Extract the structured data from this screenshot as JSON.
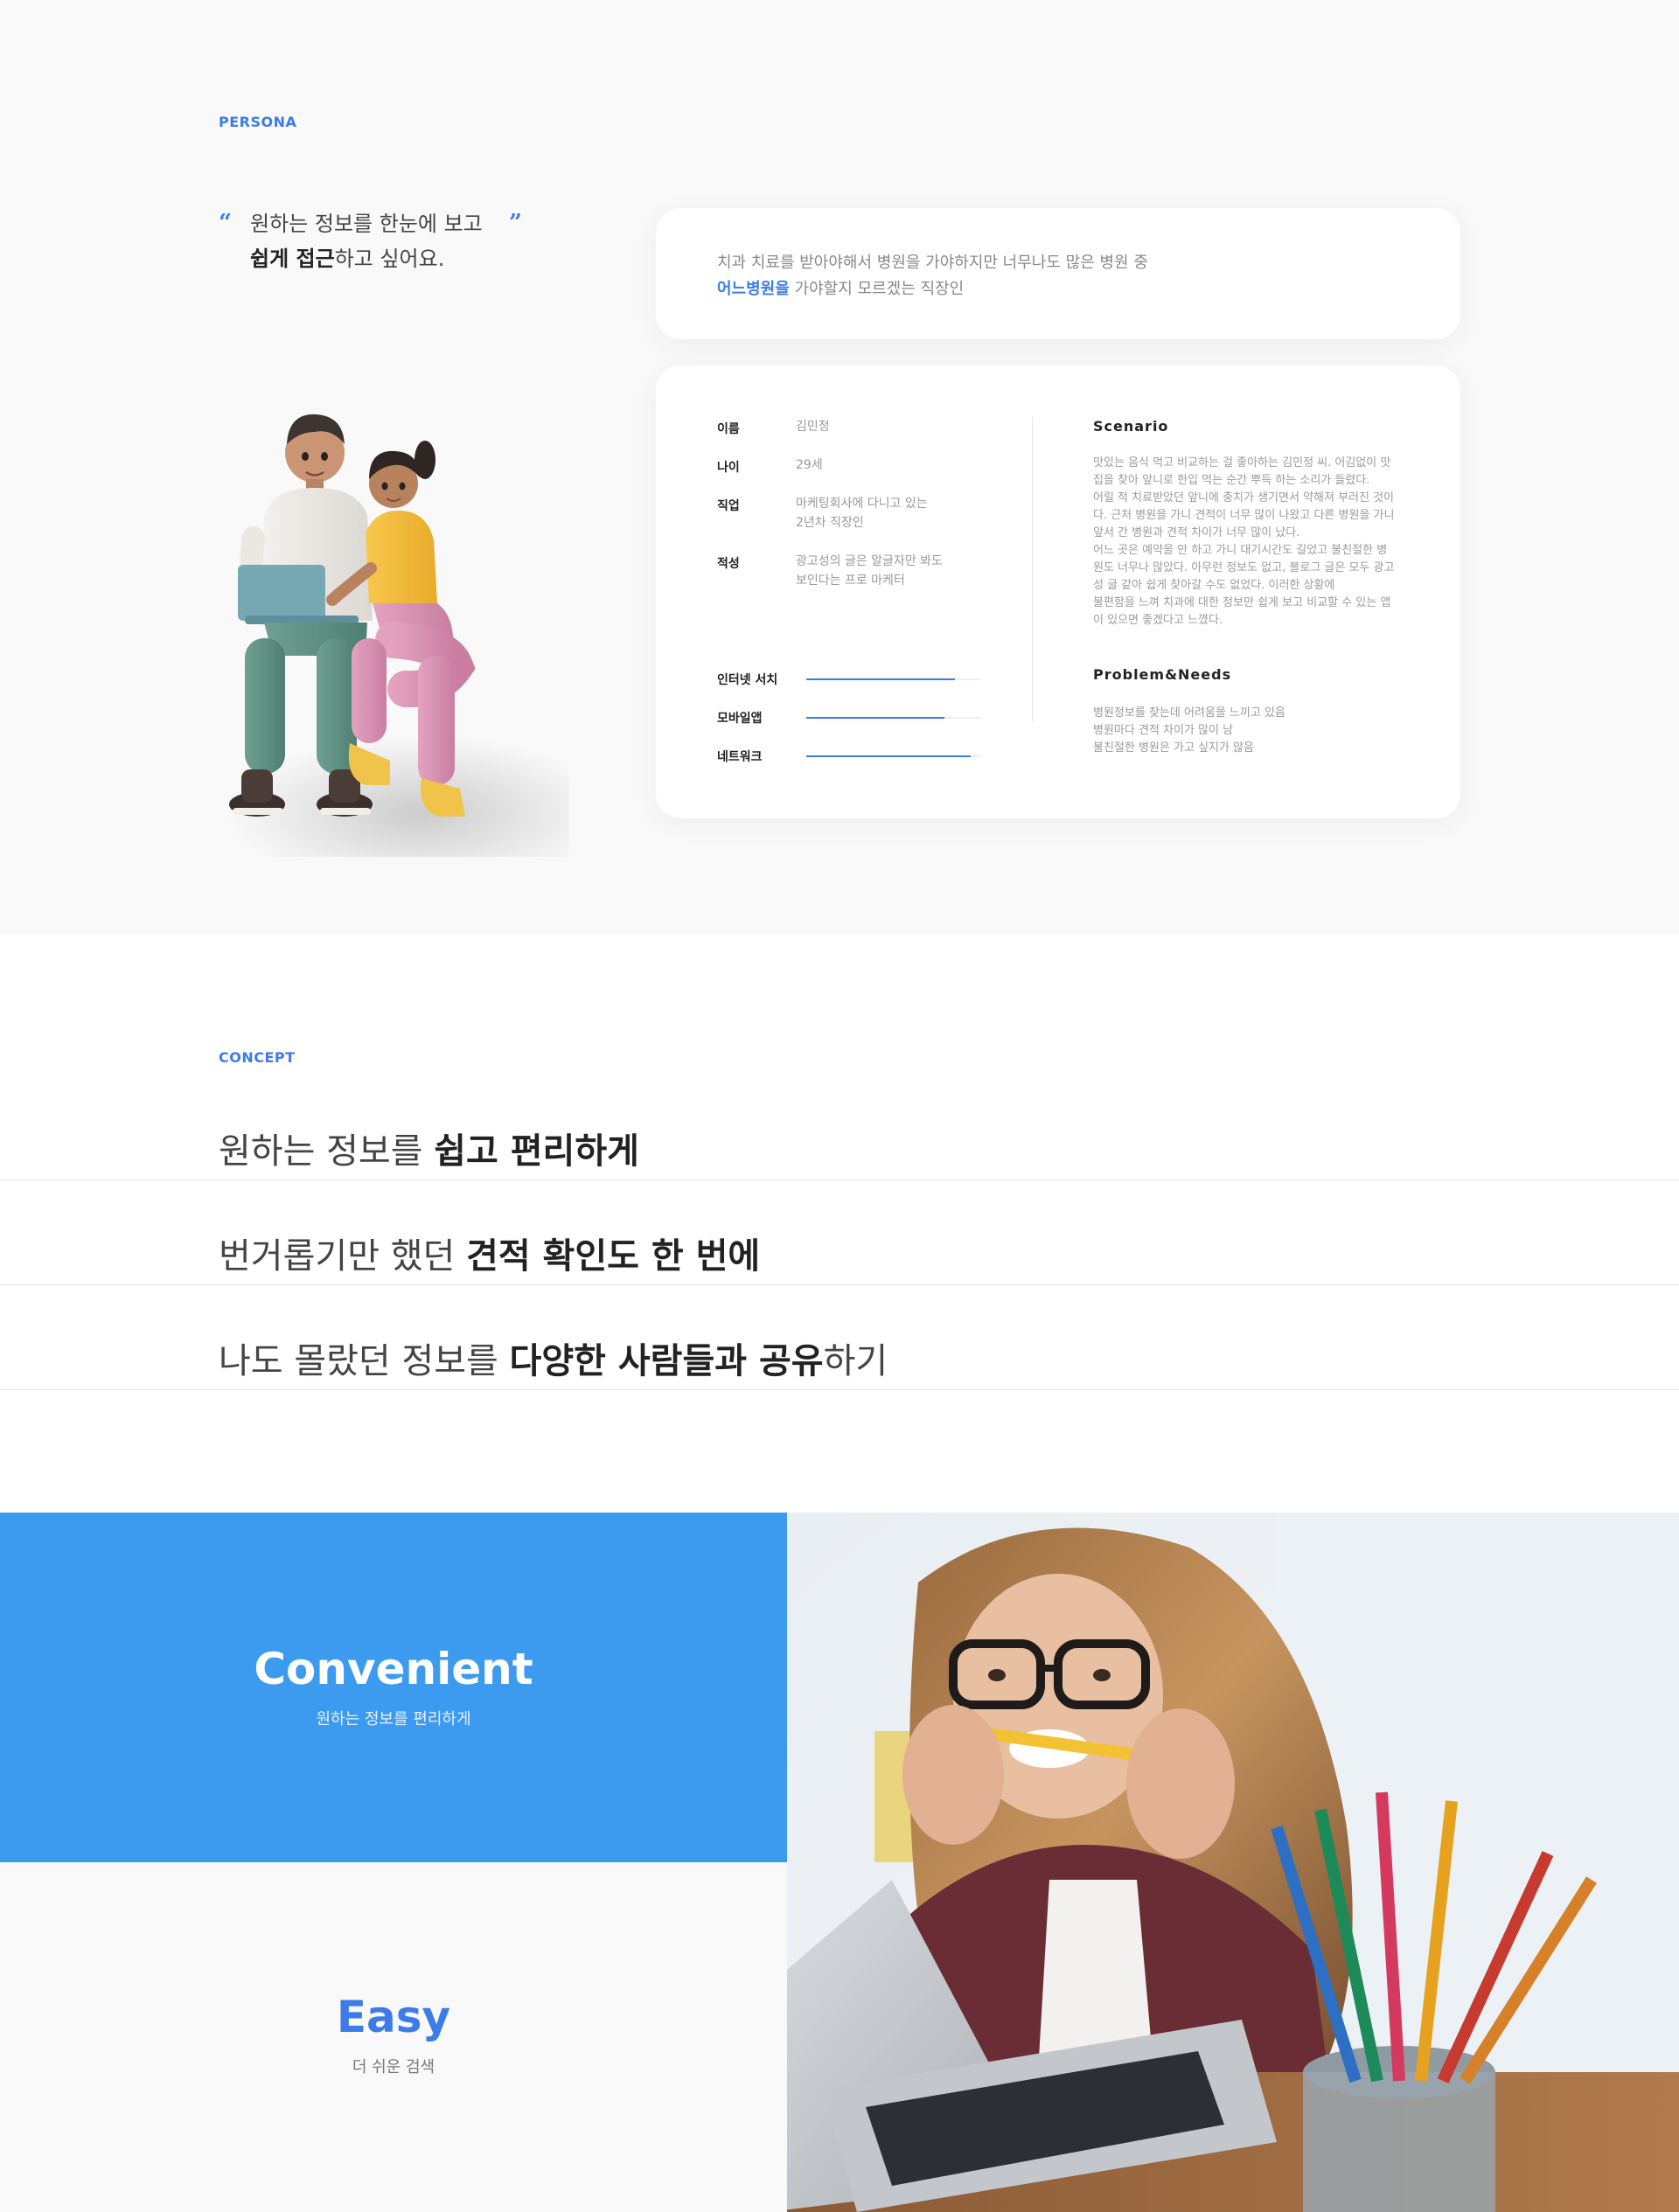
{
  "persona": {
    "label": "PERSONA",
    "quote": {
      "open_mark": "“",
      "close_mark": "”",
      "line1": "원하는 정보를 한눈에 보고",
      "line2_bold": "쉽게 접근",
      "line2_rest": "하고 싶어요."
    },
    "description": {
      "line1": "치과 치료를 받아야해서 병원을 가야하지만 너무나도 많은 병원 중",
      "line2_accent": "어느병원을",
      "line2_rest": " 가야할지 모르겠는 직장인"
    },
    "info": [
      {
        "key": "이름",
        "value": [
          "김민정"
        ]
      },
      {
        "key": "나이",
        "value": [
          "29세"
        ]
      },
      {
        "key": "직업",
        "value": [
          "마케팅회사에 다니고 있는",
          "2년차 직장인"
        ]
      },
      {
        "key": "적성",
        "value": [
          "광고성의 글은 알글자만 봐도",
          "보인다는 프로 마케터"
        ]
      }
    ],
    "skills": [
      {
        "name": "인터넷 서치",
        "level": 0.85
      },
      {
        "name": "모바일앱",
        "level": 0.79
      },
      {
        "name": "네트워크",
        "level": 0.94
      }
    ],
    "scenario": {
      "title": "Scenario",
      "lines": [
        "맛있는 음식 먹고 비교하는 걸 좋아하는 김민정 씨. 어김없이 맛",
        "집을 찾아 앞니로 한입 먹는 순간 뿌득 하는 소리가 들렸다.",
        "어릴 적 치료받았던 앞니에 충치가 생기면서 약해져 부러진 것이",
        "다. 근처 병원을 가니 견적이 너무 많이 나왔고 다른 병원을 가니",
        "앞서 간 병원과 견적 차이가 너무 많이 났다.",
        "어느 곳은 예약을 안 하고 가니 대기시간도 길었고 불친절한 병",
        "원도 너무나 많았다. 아무런 정보도 없고, 블로그 글은 모두 광고",
        "성 글 같아 쉽게 찾아갈 수도 없었다. 이러한 상황에",
        "불편함을 느껴 치과에 대한 정보만 쉽게 보고 비교할 수 있는 앱",
        "이 있으면 좋겠다고 느꼈다."
      ]
    },
    "needs": {
      "title": "Problem&Needs",
      "lines": [
        "병원정보를 찾는데 어려움을 느끼고 있음",
        "병원마다 견적 차이가 많이 남",
        "불친절한 병원은 가고 싶지가 않음"
      ]
    }
  },
  "concept": {
    "label": "CONCEPT",
    "rows": [
      {
        "pre": "원하는 정보를 ",
        "bold": "쉽고 편리하게",
        "post": ""
      },
      {
        "pre": "번거롭기만 했던 ",
        "bold": "견적 확인도 한 번에",
        "post": ""
      },
      {
        "pre": "나도 몰랐던 정보를 ",
        "bold": "다양한 사람들과 공유",
        "post": "하기"
      }
    ]
  },
  "features": [
    {
      "title": "Convenient",
      "subtitle": "원하는 정보를 편리하게"
    },
    {
      "title": "Easy",
      "subtitle": "더 쉬운 검색"
    }
  ],
  "colors": {
    "accent": "#3d7be8",
    "feature_blue": "#3c9bef",
    "section_bg": "#f9f9f9"
  }
}
